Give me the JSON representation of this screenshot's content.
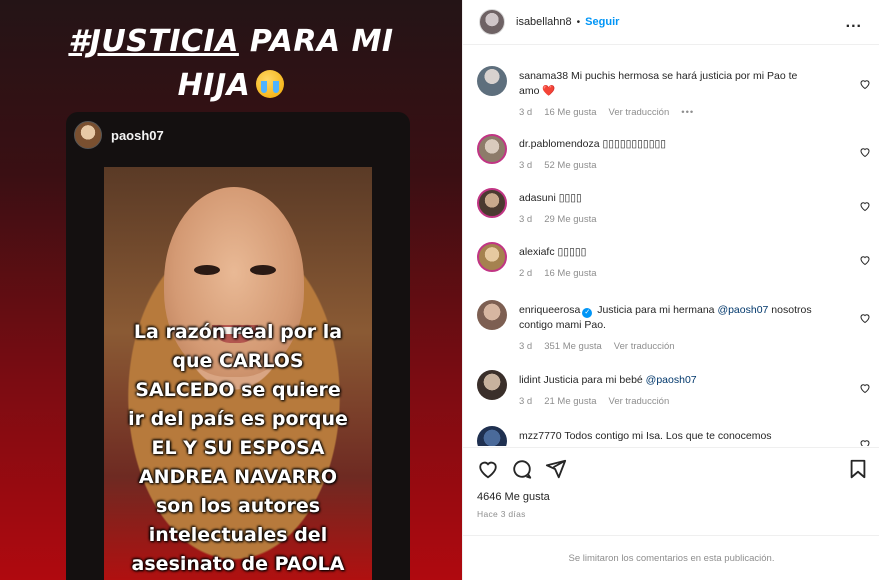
{
  "media": {
    "headline_tag": "#JUSTICIA",
    "headline_rest": " PARA MI",
    "headline_line2": "HIJA",
    "story_username": "paosh07",
    "story_text": [
      "La razón real por la",
      "que CARLOS",
      "SALCEDO se quiere",
      "ir del país es porque",
      "EL Y SU ESPOSA",
      "ANDREA NAVARRO",
      "son los autores",
      "intelectuales del",
      "asesinato de PAOLA"
    ]
  },
  "post": {
    "username": "isabellahn8",
    "separator": "•",
    "follow_label": "Seguir",
    "more_label": "...",
    "likes": "4646 Me gusta",
    "time_ago": "Hace 3 días",
    "comments_limited": "Se limitaron los comentarios en esta publicación."
  },
  "comments": [
    {
      "user": "sanama38",
      "text": "Mi puchis hermosa se hará justicia por mi Pao te amo ❤️",
      "time": "3 d",
      "likes": "16 Me gusta",
      "translate": "Ver traducción",
      "more": "•••"
    },
    {
      "user": "dr.pablomendoza",
      "text": "▯▯▯▯▯▯▯▯▯▯▯",
      "time": "3 d",
      "likes": "52 Me gusta"
    },
    {
      "user": "adasuni",
      "text": "▯▯▯▯",
      "time": "3 d",
      "likes": "29 Me gusta"
    },
    {
      "user": "alexiafc",
      "text": "▯▯▯▯▯",
      "time": "2 d",
      "likes": "16 Me gusta"
    },
    {
      "user": "enriqueerosa",
      "text_before": "Justicia para mi hermana ",
      "mention": "@paosh07",
      "text_after": " nosotros contigo mami Pao.",
      "time": "3 d",
      "likes": "351 Me gusta",
      "translate": "Ver traducción"
    },
    {
      "user": "lidint",
      "text_before": "Justicia para mi bebé ",
      "mention": "@paosh07",
      "time": "3 d",
      "likes": "21 Me gusta",
      "translate": "Ver traducción"
    },
    {
      "user": "mzz7770",
      "text": "Todos contigo mi Isa. Los que te conocemos"
    }
  ],
  "colors": {
    "accent": "#0095f6",
    "gradient_bottom": "#b0090f"
  },
  "icons": [
    "heart-icon",
    "comment-icon",
    "share-icon",
    "bookmark-icon",
    "verified-icon",
    "crying-emoji-icon"
  ]
}
